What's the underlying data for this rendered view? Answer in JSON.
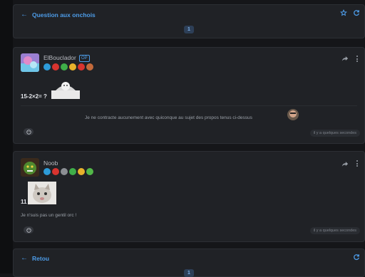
{
  "topic": {
    "title": "Question aux onchois",
    "page_current": "1",
    "icons": [
      "arrow-left-icon",
      "star-icon",
      "refresh-icon"
    ]
  },
  "posts": [
    {
      "author": "ElBouclador",
      "op_label": "OP",
      "badges": [
        "#2d9bd8",
        "#d8342f",
        "#3fae49",
        "#e8b22c",
        "#d8342f",
        "#c36a3b"
      ],
      "content_text": "15-2×2= ?",
      "signature": "Je ne contracte aucunement avec quiconque au sujet des propos tenus ci-dessus",
      "timestamp": "il y a quelques secondes"
    },
    {
      "author": "Noob",
      "badges": [
        "#2d9bd8",
        "#d8342f",
        "#8c8f94",
        "#3fae49",
        "#e8b22c",
        "#52b848"
      ],
      "content_number": "11",
      "content_text": "Je n'suis pas un gentil orc !",
      "timestamp": "il y a quelques secondes"
    }
  ],
  "footer": {
    "back_label": "Retou",
    "page_current": "1"
  },
  "colors": {
    "accent": "#4d9ce8",
    "card": "#202226",
    "background": "#151619"
  }
}
